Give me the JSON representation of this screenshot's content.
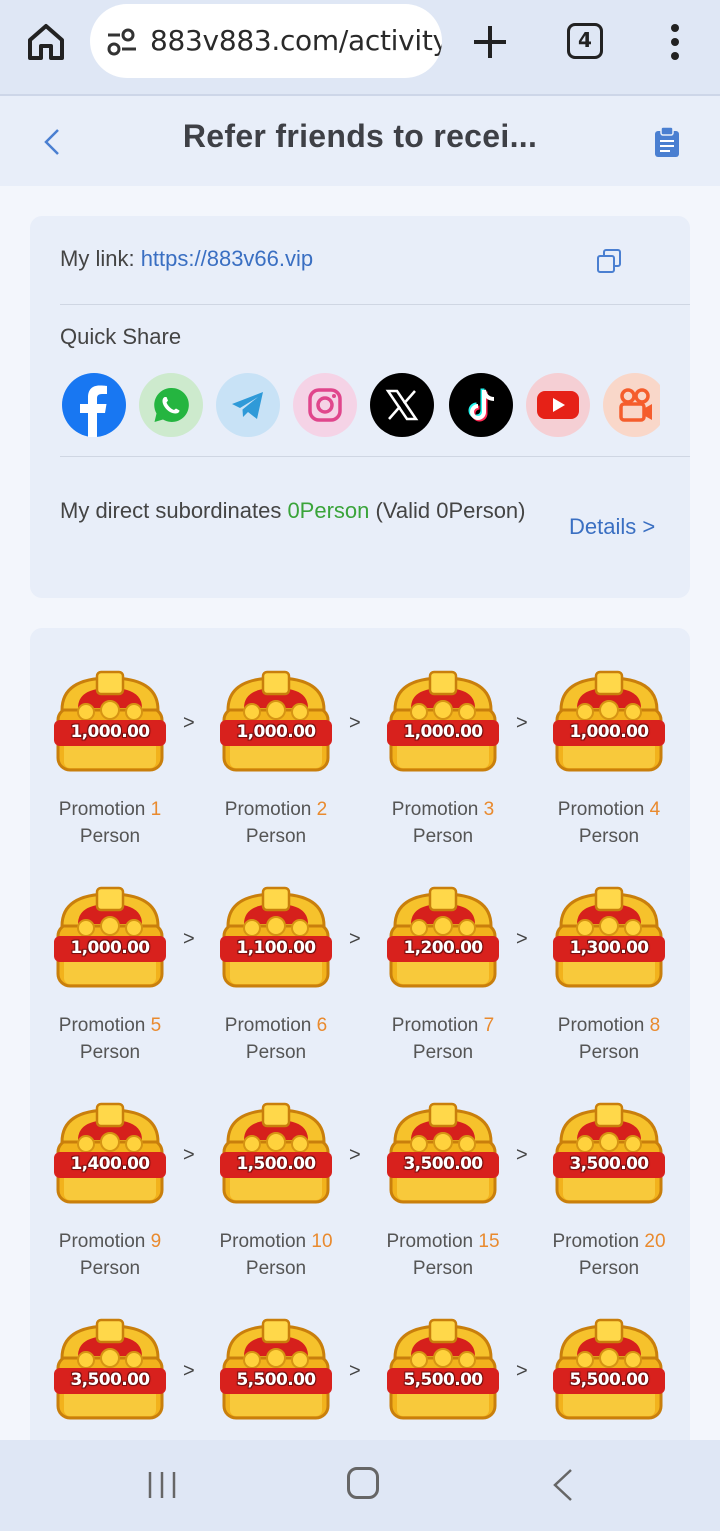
{
  "browser": {
    "url": "883v883.com/activity",
    "tab_count": "4"
  },
  "header": {
    "title": "Refer friends to recei..."
  },
  "link_card": {
    "my_link_label": "My link: ",
    "my_link_url": "https://883v66.vip",
    "quick_share_label": "Quick Share",
    "share_icons": [
      "facebook-icon",
      "whatsapp-icon",
      "telegram-icon",
      "instagram-icon",
      "x-icon",
      "tiktok-icon",
      "youtube-icon",
      "kwai-icon"
    ],
    "subs_prefix": "My direct subordinates ",
    "subs_count": "0Person",
    "subs_suffix": " (Valid 0Person)",
    "details_label": "Details >"
  },
  "rewards": {
    "promotion_label": "Promotion",
    "person_label": "Person",
    "separator": ">",
    "items": [
      {
        "amount": "1,000.00",
        "count": "1"
      },
      {
        "amount": "1,000.00",
        "count": "2"
      },
      {
        "amount": "1,000.00",
        "count": "3"
      },
      {
        "amount": "1,000.00",
        "count": "4"
      },
      {
        "amount": "1,000.00",
        "count": "5"
      },
      {
        "amount": "1,100.00",
        "count": "6"
      },
      {
        "amount": "1,200.00",
        "count": "7"
      },
      {
        "amount": "1,300.00",
        "count": "8"
      },
      {
        "amount": "1,400.00",
        "count": "9"
      },
      {
        "amount": "1,500.00",
        "count": "10"
      },
      {
        "amount": "3,500.00",
        "count": "15"
      },
      {
        "amount": "3,500.00",
        "count": "20"
      },
      {
        "amount": "3,500.00",
        "count": ""
      },
      {
        "amount": "5,500.00",
        "count": ""
      },
      {
        "amount": "5,500.00",
        "count": ""
      },
      {
        "amount": "5,500.00",
        "count": ""
      }
    ]
  },
  "colors": {
    "accent_blue": "#3a6fc2",
    "promo_orange": "#e98a2e",
    "green": "#3aa43a"
  }
}
